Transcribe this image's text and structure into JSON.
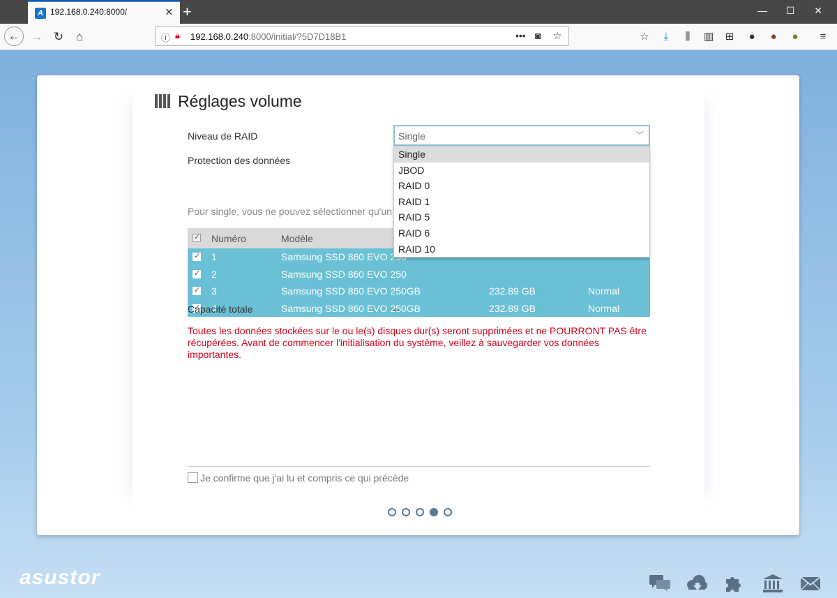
{
  "browser": {
    "tab_title": "192.168.0.240:8000/",
    "tab_favicon": "A",
    "url_host": "192.168.0.240",
    "url_rest": ":8000/initial/?5D7D18B1",
    "icons": [
      "back-icon",
      "forward-icon",
      "reload-icon",
      "home-icon",
      "info-icon",
      "insecure-lock-icon",
      "more-icon",
      "pocket-icon",
      "bookmark-star-icon",
      "reader-icon",
      "download-icon",
      "library-icon",
      "sidebar-icon",
      "extension-icon",
      "profile-icon",
      "menu-icon"
    ]
  },
  "page": {
    "title": "Réglages volume",
    "raid_label": "Niveau de RAID",
    "raid_value": "Single",
    "protection_label": "Protection des données",
    "hint": "Pour single, vous ne pouvez sélectionner qu'un se",
    "table": {
      "headers": [
        "Numéro",
        "Modèle"
      ],
      "rows": [
        {
          "num": "1",
          "model": "Samsung SSD 860 EVO 250",
          "size": "",
          "status": ""
        },
        {
          "num": "2",
          "model": "Samsung SSD 860 EVO 250",
          "size": "",
          "status": ""
        },
        {
          "num": "3",
          "model": "Samsung SSD 860 EVO 250GB",
          "size": "232.89 GB",
          "status": "Normal"
        },
        {
          "num": "4",
          "model": "Samsung SSD 860 EVO 250GB",
          "size": "232.89 GB",
          "status": "Normal"
        }
      ]
    },
    "dropdown_options": [
      "Single",
      "JBOD",
      "RAID 0",
      "RAID 1",
      "RAID 5",
      "RAID 6",
      "RAID 10"
    ],
    "dropdown_selected": "Single",
    "capacity_label": "Capacité totale",
    "capacity_value": "--",
    "warning_line1": "Toutes les données stockées sur le ou le(s) disques dur(s) seront supprimées et ne POURRONT PAS être",
    "warning_line2": "récupérées. Avant de commencer l'initialisation du système, veillez à sauvegarder vos données importantes.",
    "confirm_label": "Je confirme que j'ai lu et compris ce qui précède",
    "steps_total": 5,
    "steps_current": 4
  },
  "footer": {
    "brand": "asustor",
    "icons": [
      "chat-icon",
      "cloud-download-icon",
      "puzzle-icon",
      "bank-icon",
      "mail-icon"
    ]
  },
  "colors": {
    "accent": "#6ac0d4",
    "warning": "#d0021b",
    "background": "#a7cdec"
  }
}
